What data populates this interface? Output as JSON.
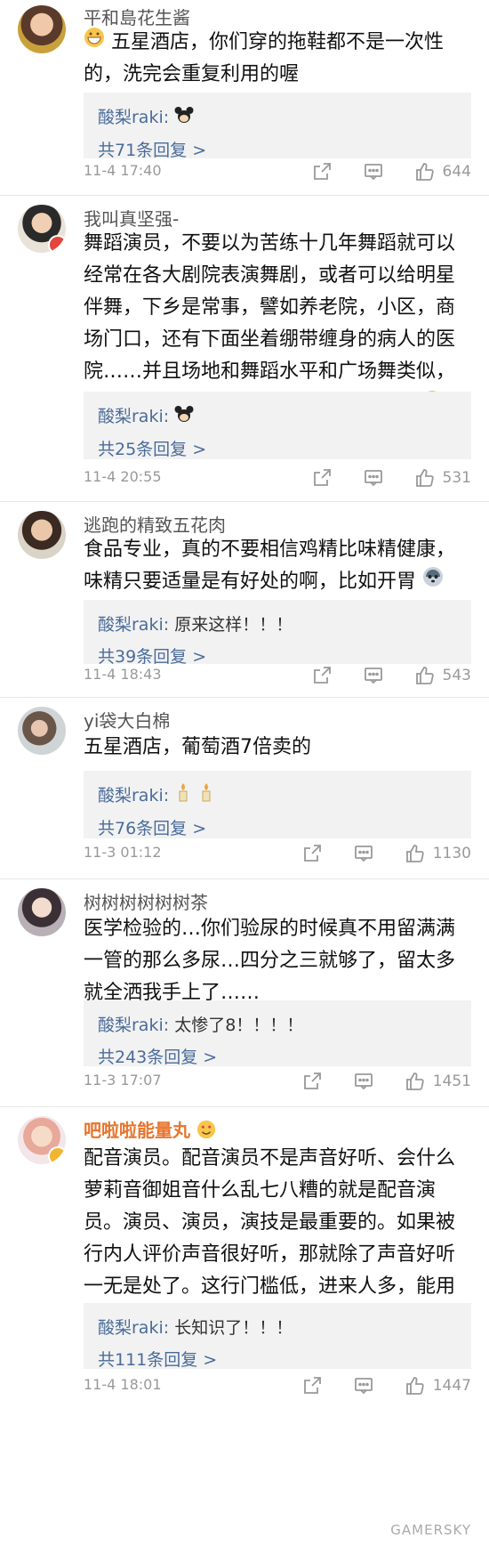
{
  "comments": [
    {
      "username": "平和島花生酱",
      "text": "五星酒店，你们穿的拖鞋都不是一次性的，洗完会重复利用的喔",
      "reply_author": "酸梨raki:",
      "reply_text": "",
      "more": "共71条回复 >",
      "time": "11-4 17:40",
      "likes": "644"
    },
    {
      "username": "我叫真坚强-",
      "text": "舞蹈演员，不要以为苦练十几年舞蹈就可以经常在各大剧院表演舞剧，或者可以给明星伴舞，下乡是常事，譬如养老院，小区，商场门口，还有下面坐着绷带缠身的病人的医院……并且场地和舞蹈水平和广场舞类似，再厉害的舞蹈团体要有这样形式的演出",
      "reply_author": "酸梨raki:",
      "reply_text": "",
      "more": "共25条回复 >",
      "time": "11-4 20:55",
      "likes": "531"
    },
    {
      "username": "逃跑的精致五花肉",
      "text": "食品专业，真的不要相信鸡精比味精健康，味精只要适量是有好处的啊，比如开胃",
      "reply_author": "酸梨raki:",
      "reply_text": "原来这样！！！",
      "more": "共39条回复 >",
      "time": "11-4 18:43",
      "likes": "543"
    },
    {
      "username": "yi袋大白棉",
      "text": "五星酒店，葡萄酒7倍卖的",
      "reply_author": "酸梨raki:",
      "reply_text": "",
      "more": "共76条回复 >",
      "time": "11-3 01:12",
      "likes": "1130"
    },
    {
      "username": "树树树树树树茶",
      "text": "医学检验的…你们验尿的时候真不用留满满一管的那么多尿…四分之三就够了，留太多就全洒我手上了……",
      "reply_author": "酸梨raki:",
      "reply_text": "太惨了8！！！！",
      "more": "共243条回复 >",
      "time": "11-3 17:07",
      "likes": "1451"
    },
    {
      "username": "吧啦啦能量丸",
      "text": "配音演员。配音演员不是声音好听、会什么萝莉音御姐音什么乱七八糟的就是配音演员。演员、演员，演技是最重要的。如果被行内人评价声音很好听，那就除了声音好听一无是处了。这行门槛低，进来人多，能用的人却很少。",
      "reply_author": "酸梨raki:",
      "reply_text": "长知识了！！！",
      "more": "共111条回复 >",
      "time": "11-4 18:01",
      "likes": "1447"
    }
  ],
  "icons": {
    "share": "share-icon",
    "comment": "comment-icon",
    "like": "thumbs-up-icon"
  },
  "colors": {
    "link": "#4a6c9a",
    "vip_name": "#e8742c",
    "reply_bg": "#f2f2f2"
  },
  "watermark": "GAMERSKY"
}
